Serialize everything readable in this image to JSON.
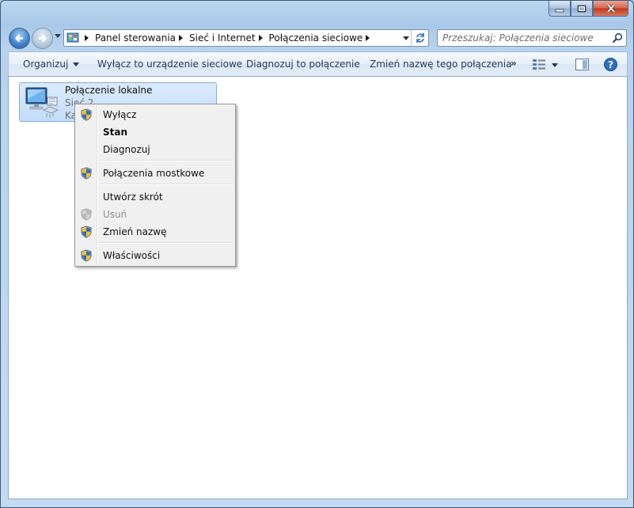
{
  "window": {
    "caption_buttons": {
      "minimize": "minimize-icon",
      "maximize": "maximize-icon",
      "close": "close-icon"
    }
  },
  "nav": {
    "breadcrumbs": [
      "Panel sterowania",
      "Sieć i Internet",
      "Połączenia sieciowe"
    ],
    "search_placeholder": "Przeszukaj: Połączenia sieciowe"
  },
  "toolbar": {
    "organize": "Organizuj",
    "disable_device": "Wyłącz to urządzenie sieciowe",
    "diagnose": "Diagnozuj to połączenie",
    "rename": "Zmień nazwę tego połączenia",
    "more": "»"
  },
  "connection": {
    "name": "Połączenie lokalne",
    "line2": "Sieć 2",
    "line3": "Ka"
  },
  "context_menu": {
    "items": [
      {
        "label": "Wyłącz",
        "shield": true,
        "bold": false,
        "enabled": true
      },
      {
        "label": "Stan",
        "shield": false,
        "bold": true,
        "enabled": true
      },
      {
        "label": "Diagnozuj",
        "shield": false,
        "bold": false,
        "enabled": true
      },
      {
        "label": "Połączenia mostkowe",
        "shield": true,
        "bold": false,
        "enabled": true
      },
      {
        "label": "Utwórz skrót",
        "shield": false,
        "bold": false,
        "enabled": true
      },
      {
        "label": "Usuń",
        "shield": true,
        "bold": false,
        "enabled": false
      },
      {
        "label": "Zmień nazwę",
        "shield": true,
        "bold": false,
        "enabled": true
      },
      {
        "label": "Właściwości",
        "shield": true,
        "bold": false,
        "enabled": true
      }
    ]
  },
  "colors": {
    "frame": "#a9c8e8",
    "selection": "#c1dcfc",
    "command_text": "#1e395b",
    "disabled_text": "#8d8d8d"
  }
}
